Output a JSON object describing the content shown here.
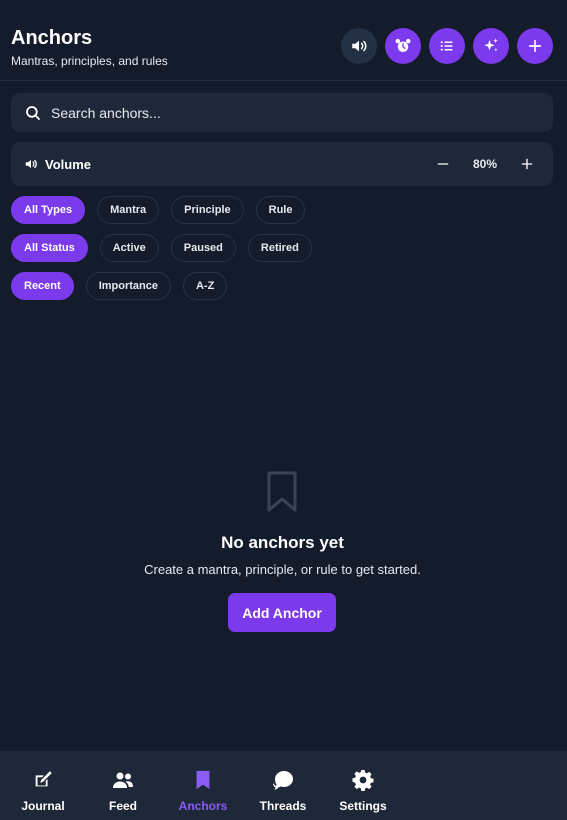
{
  "header": {
    "title": "Anchors",
    "subtitle": "Mantras, principles, and rules",
    "buttons": [
      "volume-icon",
      "alarm-icon",
      "list-icon",
      "sparkles-icon",
      "plus-icon"
    ]
  },
  "search": {
    "placeholder": "Search anchors..."
  },
  "volume": {
    "label": "Volume",
    "value": "80%",
    "level": 0.8
  },
  "filters": {
    "types": [
      {
        "label": "All Types",
        "active": true
      },
      {
        "label": "Mantra",
        "active": false
      },
      {
        "label": "Principle",
        "active": false
      },
      {
        "label": "Rule",
        "active": false
      }
    ],
    "status": [
      {
        "label": "All Status",
        "active": true
      },
      {
        "label": "Active",
        "active": false
      },
      {
        "label": "Paused",
        "active": false
      },
      {
        "label": "Retired",
        "active": false
      }
    ],
    "sort": [
      {
        "label": "Recent",
        "active": true
      },
      {
        "label": "Importance",
        "active": false
      },
      {
        "label": "A-Z",
        "active": false
      }
    ]
  },
  "empty": {
    "title": "No anchors yet",
    "text": "Create a mantra, principle, or rule to get started.",
    "button": "Add Anchor"
  },
  "nav": [
    {
      "label": "Journal",
      "icon": "journal-icon",
      "active": false
    },
    {
      "label": "Feed",
      "icon": "users-icon",
      "active": false
    },
    {
      "label": "Anchors",
      "icon": "bookmark-icon",
      "active": true
    },
    {
      "label": "Threads",
      "icon": "chat-icon",
      "active": false
    },
    {
      "label": "Settings",
      "icon": "gear-icon",
      "active": false
    }
  ],
  "colors": {
    "background": "#141b2b",
    "surface": "#1f2838",
    "accent": "#7c3aed",
    "accent_text": "#8b5cf6"
  }
}
